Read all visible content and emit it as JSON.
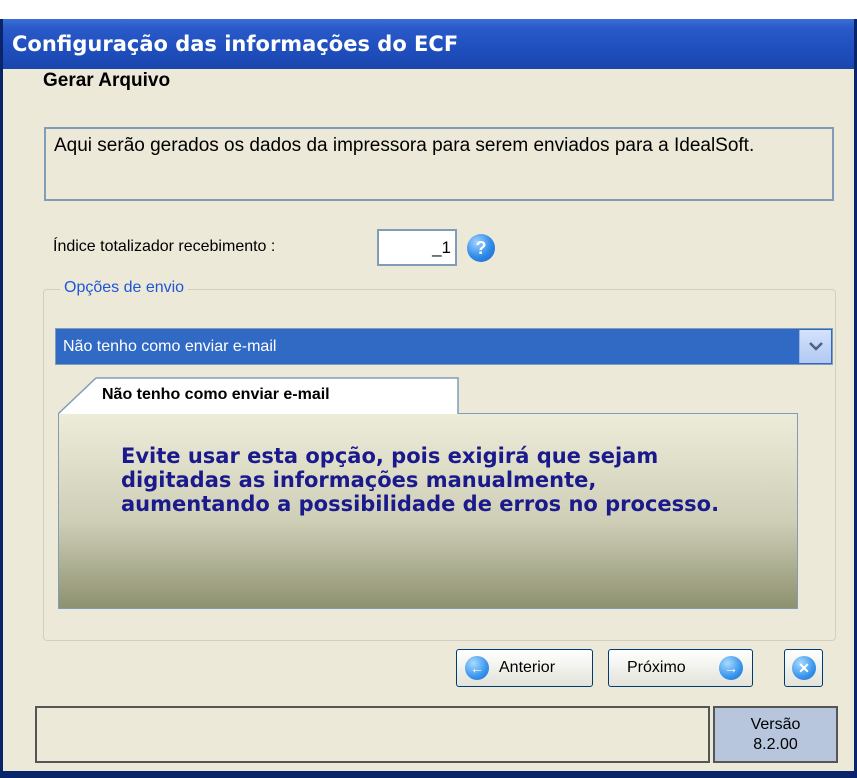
{
  "window": {
    "title": "Configuração das informações do ECF"
  },
  "section": {
    "title": "Gerar Arquivo"
  },
  "description": "Aqui serão gerados os dados da impressora para serem enviados para a IdealSoft.",
  "index_field": {
    "label": "Índice totalizador recebimento :",
    "value": "_1",
    "help_icon": "?"
  },
  "send_options": {
    "legend": "Opções de envio",
    "selected": "Não tenho como enviar e-mail",
    "tab_title": "Não tenho como enviar e-mail",
    "message": "Evite usar esta opção, pois exigirá que sejam digitadas as informações manualmente, aumentando a possibilidade de erros no processo."
  },
  "buttons": {
    "previous": "Anterior",
    "next": "Próximo"
  },
  "status": {
    "version_label": "Versão",
    "version": "8.2.00"
  },
  "colors": {
    "titlebar": "#1f4fbe",
    "selection": "#316ac5",
    "message_text": "#1a1a8c",
    "version_box": "#b7c6dc"
  },
  "icons": [
    "help-icon",
    "chevron-down-icon",
    "arrow-left-icon",
    "arrow-right-icon",
    "close-icon"
  ]
}
